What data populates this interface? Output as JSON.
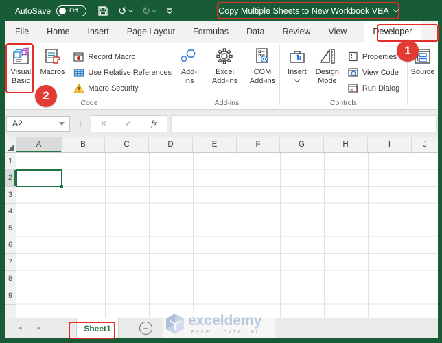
{
  "titlebar": {
    "autosave_label": "AutoSave",
    "autosave_state": "Off",
    "document_title": "Copy Multiple Sheets to New Workbook VBA"
  },
  "tabs": {
    "file": "File",
    "home": "Home",
    "insert": "Insert",
    "page_layout": "Page Layout",
    "formulas": "Formulas",
    "data": "Data",
    "review": "Review",
    "view": "View",
    "developer": "Developer"
  },
  "ribbon": {
    "code_group": {
      "label": "Code",
      "visual_basic_line1": "Visual",
      "visual_basic_line2": "Basic",
      "macros": "Macros",
      "record_macro": "Record Macro",
      "use_relative_references": "Use Relative References",
      "macro_security": "Macro Security"
    },
    "addins_group": {
      "label": "Add-ins",
      "addins_line1": "Add-",
      "addins_line2": "ins",
      "excel_addins_line1": "Excel",
      "excel_addins_line2": "Add-ins",
      "com_addins_line1": "COM",
      "com_addins_line2": "Add-ins"
    },
    "controls_group": {
      "label": "Controls",
      "insert": "Insert",
      "design_mode_line1": "Design",
      "design_mode_line2": "Mode",
      "properties": "Properties",
      "view_code": "View Code",
      "run_dialog": "Run Dialog"
    },
    "xml_group": {
      "source": "Source"
    }
  },
  "annotations": {
    "step1": "1",
    "step2": "2"
  },
  "formula_bar": {
    "name_box_value": "A2",
    "dots": "⋮",
    "cancel_glyph": "×",
    "enter_glyph": "✓",
    "fx_label": "fx",
    "formula_value": ""
  },
  "grid": {
    "columns": [
      "A",
      "B",
      "C",
      "D",
      "E",
      "F",
      "G",
      "H",
      "I",
      "J"
    ],
    "rows": [
      "1",
      "2",
      "3",
      "4",
      "5",
      "6",
      "7",
      "8",
      "9"
    ],
    "selected_cell": "A2",
    "selected_column": "A",
    "selected_row": "2"
  },
  "sheet_bar": {
    "sheet_name": "Sheet1",
    "add_sheet_glyph": "+",
    "prev_glyph": "◂",
    "next_glyph": "▸"
  },
  "watermark": {
    "brand": "exceldemy",
    "tagline": "EXCEL - DATA - BI"
  },
  "colors": {
    "excel_green": "#185C37",
    "accent_green": "#217346",
    "annotation_red": "#E22E28"
  }
}
